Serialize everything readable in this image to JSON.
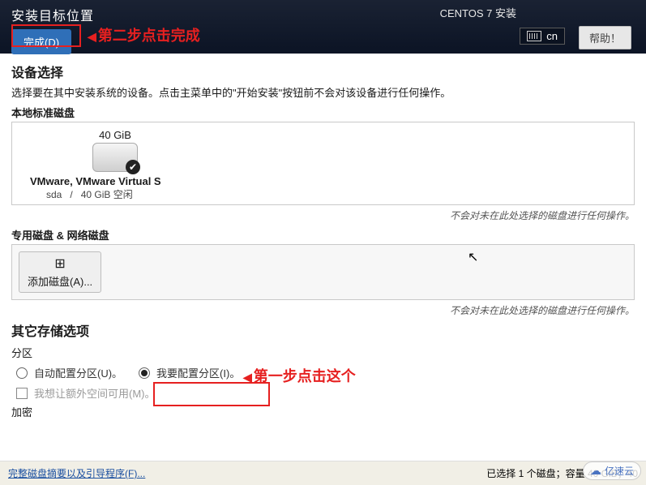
{
  "topbar": {
    "title": "安装目标位置",
    "installer_name": "CENTOS 7 安装",
    "done_label": "完成(D)",
    "lang_code": "cn",
    "help_label": "帮助！"
  },
  "annotations": {
    "step2": "第二步点击完成",
    "step1": "第一步点击这个"
  },
  "device": {
    "heading": "设备选择",
    "desc": "选择要在其中安装系统的设备。点击主菜单中的\"开始安装\"按钮前不会对该设备进行任何操作。",
    "local_heading": "本地标准磁盘",
    "disk": {
      "capacity": "40 GiB",
      "name": "VMware, VMware Virtual S",
      "details_id": "sda",
      "details_sep": "/",
      "details_free": "40 GiB 空闲"
    },
    "note_no_action": "不会对未在此处选择的磁盘进行任何操作。",
    "special_heading": "专用磁盘 & 网络磁盘",
    "add_disk_label": "添加磁盘(A)..."
  },
  "storage": {
    "heading": "其它存储选项",
    "partition_heading": "分区",
    "auto_label": "自动配置分区(U)。",
    "custom_label": "我要配置分区(I)。",
    "extra_label": "我想让额外空间可用(M)。",
    "encrypt_heading": "加密"
  },
  "bottom": {
    "link": "完整磁盘摘要以及引导程序(F)...",
    "status": "已选择 1 个磁盘；容量 40 GiB；40"
  },
  "watermark": "亿速云"
}
